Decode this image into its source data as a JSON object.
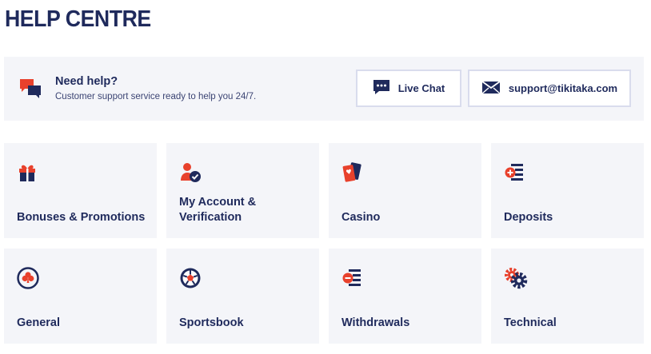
{
  "page": {
    "title": "HELP CENTRE"
  },
  "help": {
    "title": "Need help?",
    "subtitle": "Customer support service ready to help you 24/7.",
    "live_chat_label": "Live Chat",
    "email_label": "support@tikitaka.com"
  },
  "categories": [
    {
      "label": "Bonuses & Promotions",
      "icon": "gift-icon"
    },
    {
      "label": "My Account & Verification",
      "icon": "user-check-icon"
    },
    {
      "label": "Casino",
      "icon": "playing-cards-icon"
    },
    {
      "label": "Deposits",
      "icon": "deposit-icon"
    },
    {
      "label": "General",
      "icon": "clover-icon"
    },
    {
      "label": "Sportsbook",
      "icon": "football-icon"
    },
    {
      "label": "Withdrawals",
      "icon": "withdrawal-icon"
    },
    {
      "label": "Technical",
      "icon": "gear-icon"
    }
  ],
  "colors": {
    "navy": "#1f2a5c",
    "red": "#e8412c",
    "card_bg": "#f4f5f9",
    "border": "#d9dced"
  }
}
